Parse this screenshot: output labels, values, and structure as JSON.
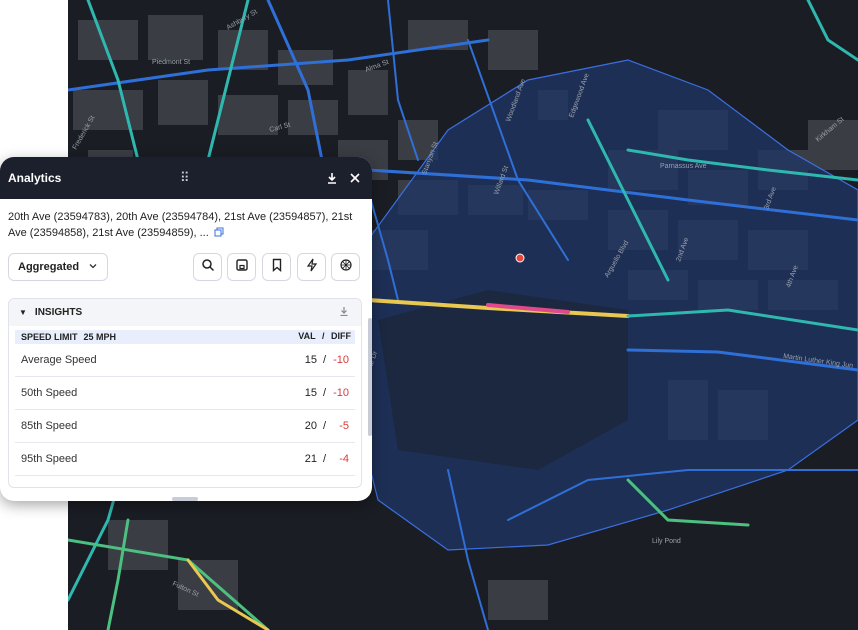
{
  "map": {
    "background": "#1a1d24",
    "selection_fill": "#1f3566",
    "streets": [
      {
        "label": "Ashbury St"
      },
      {
        "label": "Piedmont St"
      },
      {
        "label": "Alma St"
      },
      {
        "label": "Carl St"
      },
      {
        "label": "Stanyan St"
      },
      {
        "label": "Willard St"
      },
      {
        "label": "Woodland Ave"
      },
      {
        "label": "Edgewood Ave"
      },
      {
        "label": "Parnassus Ave"
      },
      {
        "label": "3rd Ave"
      },
      {
        "label": "Kirkham St"
      },
      {
        "label": "Arguello Blvd"
      },
      {
        "label": "2nd Ave"
      },
      {
        "label": "4th Ave"
      },
      {
        "label": "Martin Luther King Jun"
      },
      {
        "label": "Kezar Dr"
      },
      {
        "label": "Lily Pond"
      },
      {
        "label": "Fulton St"
      },
      {
        "label": "Frederick St"
      }
    ]
  },
  "panel": {
    "title": "Analytics",
    "segments_text": "20th Ave (23594783), 20th Ave (23594784), 21st Ave (23594857), 21st Ave (23594858), 21st Ave (23594859), ...",
    "aggregation": "Aggregated",
    "toolbar_icons": [
      "search-icon",
      "save-icon",
      "bookmark-icon",
      "lightning-icon",
      "ai-spark-icon"
    ],
    "insights": {
      "title": "INSIGHTS",
      "speed_limit_label": "SPEED LIMIT",
      "speed_limit_value": "25 MPH",
      "col_val": "VAL",
      "col_sep": "/",
      "col_diff": "DIFF",
      "rows": [
        {
          "label": "Average Speed",
          "val": "15",
          "diff": "-10"
        },
        {
          "label": "50th Speed",
          "val": "15",
          "diff": "-10"
        },
        {
          "label": "85th Speed",
          "val": "20",
          "diff": "-5"
        },
        {
          "label": "95th Speed",
          "val": "21",
          "diff": "-4"
        }
      ]
    }
  }
}
